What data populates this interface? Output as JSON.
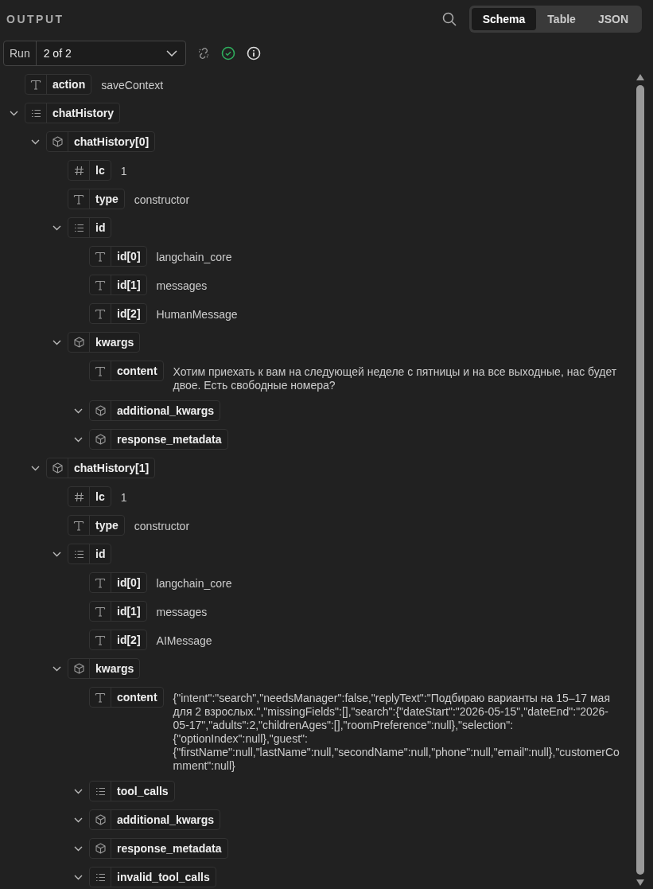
{
  "header": {
    "title": "OUTPUT",
    "views": [
      {
        "label": "Schema",
        "selected": true
      },
      {
        "label": "Table",
        "selected": false
      },
      {
        "label": "JSON",
        "selected": false
      }
    ]
  },
  "run": {
    "label": "Run",
    "value": "2 of 2"
  },
  "tree": [
    {
      "key": "action",
      "kind": "string",
      "value": "saveContext"
    },
    {
      "key": "chatHistory",
      "kind": "array",
      "expanded": true,
      "children": [
        {
          "key": "chatHistory[0]",
          "kind": "object",
          "expanded": true,
          "children": [
            {
              "key": "lc",
              "kind": "number",
              "value": "1"
            },
            {
              "key": "type",
              "kind": "string",
              "value": "constructor"
            },
            {
              "key": "id",
              "kind": "array",
              "expanded": true,
              "children": [
                {
                  "key": "id[0]",
                  "kind": "string",
                  "value": "langchain_core"
                },
                {
                  "key": "id[1]",
                  "kind": "string",
                  "value": "messages"
                },
                {
                  "key": "id[2]",
                  "kind": "string",
                  "value": "HumanMessage"
                }
              ]
            },
            {
              "key": "kwargs",
              "kind": "object",
              "expanded": true,
              "children": [
                {
                  "key": "content",
                  "kind": "string",
                  "value": "Хотим приехать к вам на следующей неделе с пятницы и на все выходные, нас будет двое. Есть свободные номера?"
                },
                {
                  "key": "additional_kwargs",
                  "kind": "object",
                  "expanded": true
                },
                {
                  "key": "response_metadata",
                  "kind": "object",
                  "expanded": true
                }
              ]
            }
          ]
        },
        {
          "key": "chatHistory[1]",
          "kind": "object",
          "expanded": true,
          "children": [
            {
              "key": "lc",
              "kind": "number",
              "value": "1"
            },
            {
              "key": "type",
              "kind": "string",
              "value": "constructor"
            },
            {
              "key": "id",
              "kind": "array",
              "expanded": true,
              "children": [
                {
                  "key": "id[0]",
                  "kind": "string",
                  "value": "langchain_core"
                },
                {
                  "key": "id[1]",
                  "kind": "string",
                  "value": "messages"
                },
                {
                  "key": "id[2]",
                  "kind": "string",
                  "value": "AIMessage"
                }
              ]
            },
            {
              "key": "kwargs",
              "kind": "object",
              "expanded": true,
              "children": [
                {
                  "key": "content",
                  "kind": "string",
                  "value": "{\"intent\":\"search\",\"needsManager\":false,\"replyText\":\"Подбираю варианты на 15–17 мая для 2 взрослых.\",\"missingFields\":[],\"search\":{\"dateStart\":\"2026-05-15\",\"dateEnd\":\"2026-05-17\",\"adults\":2,\"childrenAges\":[],\"roomPreference\":null},\"selection\":{\"optionIndex\":null},\"guest\":{\"firstName\":null,\"lastName\":null,\"secondName\":null,\"phone\":null,\"email\":null},\"customerComment\":null}"
                },
                {
                  "key": "tool_calls",
                  "kind": "array",
                  "expanded": true
                },
                {
                  "key": "additional_kwargs",
                  "kind": "object",
                  "expanded": true
                },
                {
                  "key": "response_metadata",
                  "kind": "object",
                  "expanded": true
                },
                {
                  "key": "invalid_tool_calls",
                  "kind": "array",
                  "expanded": true
                }
              ]
            }
          ]
        }
      ]
    }
  ]
}
